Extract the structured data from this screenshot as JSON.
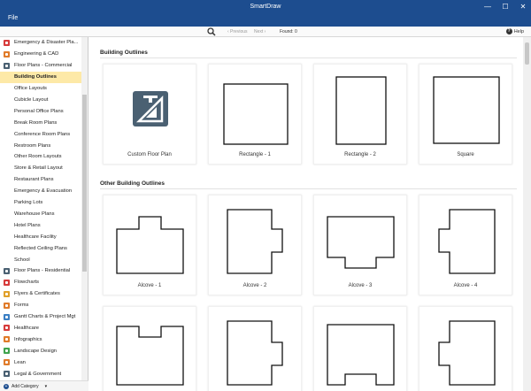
{
  "window": {
    "title": "SmartDraw",
    "menu_file": "File",
    "controls": [
      "—",
      "☐",
      "✕"
    ]
  },
  "toolbar": {
    "prev_label": "‹ Previous",
    "next_label": "Next ›",
    "found_label": "Found: 0",
    "help_label": "Help"
  },
  "sidebar": {
    "items": [
      {
        "label": "Emergency & Disaster Pla...",
        "type": "category",
        "icon_color": "#d63b3b",
        "icon": "emergency-icon"
      },
      {
        "label": "Engineering & CAD",
        "type": "category",
        "icon_color": "#e07b2a",
        "icon": "engineering-icon"
      },
      {
        "label": "Floor Plans - Commercial",
        "type": "category",
        "icon_color": "#4a6072",
        "icon": "floor-plan-icon"
      },
      {
        "label": "Building Outlines",
        "type": "sub",
        "active": true
      },
      {
        "label": "Office Layouts",
        "type": "sub"
      },
      {
        "label": "Cubicle Layout",
        "type": "sub"
      },
      {
        "label": "Personal Office Plans",
        "type": "sub"
      },
      {
        "label": "Break Room Plans",
        "type": "sub"
      },
      {
        "label": "Conference Room Plans",
        "type": "sub"
      },
      {
        "label": "Restroom Plans",
        "type": "sub"
      },
      {
        "label": "Other Room Layouts",
        "type": "sub"
      },
      {
        "label": "Store & Retail Layout",
        "type": "sub"
      },
      {
        "label": "Restaurant Plans",
        "type": "sub"
      },
      {
        "label": "Emergency & Evacuation",
        "type": "sub"
      },
      {
        "label": "Parking Lots",
        "type": "sub"
      },
      {
        "label": "Warehouse Plans",
        "type": "sub"
      },
      {
        "label": "Hotel Plans",
        "type": "sub"
      },
      {
        "label": "Healthcare Facility",
        "type": "sub"
      },
      {
        "label": "Reflected Ceiling Plans",
        "type": "sub"
      },
      {
        "label": "School",
        "type": "sub"
      },
      {
        "label": "Floor Plans - Residential",
        "type": "category",
        "icon_color": "#4a6072",
        "icon": "house-icon"
      },
      {
        "label": "Flowcharts",
        "type": "category",
        "icon_color": "#d63b3b",
        "icon": "flowchart-icon"
      },
      {
        "label": "Flyers & Certificates",
        "type": "category",
        "icon_color": "#e0a02a",
        "icon": "flyer-icon"
      },
      {
        "label": "Forms",
        "type": "category",
        "icon_color": "#e07b2a",
        "icon": "form-icon"
      },
      {
        "label": "Gantt Charts & Project Mgt",
        "type": "category",
        "icon_color": "#3b7fc4",
        "icon": "gantt-icon"
      },
      {
        "label": "Healthcare",
        "type": "category",
        "icon_color": "#d63b3b",
        "icon": "healthcare-icon"
      },
      {
        "label": "Infographics",
        "type": "category",
        "icon_color": "#e07b2a",
        "icon": "infographic-icon"
      },
      {
        "label": "Landscape Design",
        "type": "category",
        "icon_color": "#3fa34d",
        "icon": "landscape-icon"
      },
      {
        "label": "Lean",
        "type": "category",
        "icon_color": "#e07b2a",
        "icon": "lean-icon"
      },
      {
        "label": "Legal & Government",
        "type": "category",
        "icon_color": "#4a6072",
        "icon": "legal-icon"
      }
    ],
    "add_category_label": "Add Category"
  },
  "main": {
    "section1_title": "Building Outlines",
    "section2_title": "Other Building Outlines",
    "section1_cards": [
      {
        "label": "Custom Floor Plan",
        "shape": "custom"
      },
      {
        "label": "Rectangle - 1",
        "shape": "rect1"
      },
      {
        "label": "Rectangle - 2",
        "shape": "rect2"
      },
      {
        "label": "Square",
        "shape": "square"
      }
    ],
    "section2_cards": [
      {
        "label": "Alcove - 1",
        "shape": "alcove1"
      },
      {
        "label": "Alcove - 2",
        "shape": "alcove2"
      },
      {
        "label": "Alcove - 3",
        "shape": "alcove3"
      },
      {
        "label": "Alcove - 4",
        "shape": "alcove4"
      }
    ],
    "section3_cards": [
      {
        "label": "",
        "shape": "alcove5"
      },
      {
        "label": "",
        "shape": "alcove6"
      },
      {
        "label": "",
        "shape": "alcove7"
      },
      {
        "label": "",
        "shape": "alcove8"
      }
    ]
  },
  "colors": {
    "titlebar": "#1d4d8f",
    "active_item": "#fde9a7",
    "custom_icon": "#4a6072"
  }
}
